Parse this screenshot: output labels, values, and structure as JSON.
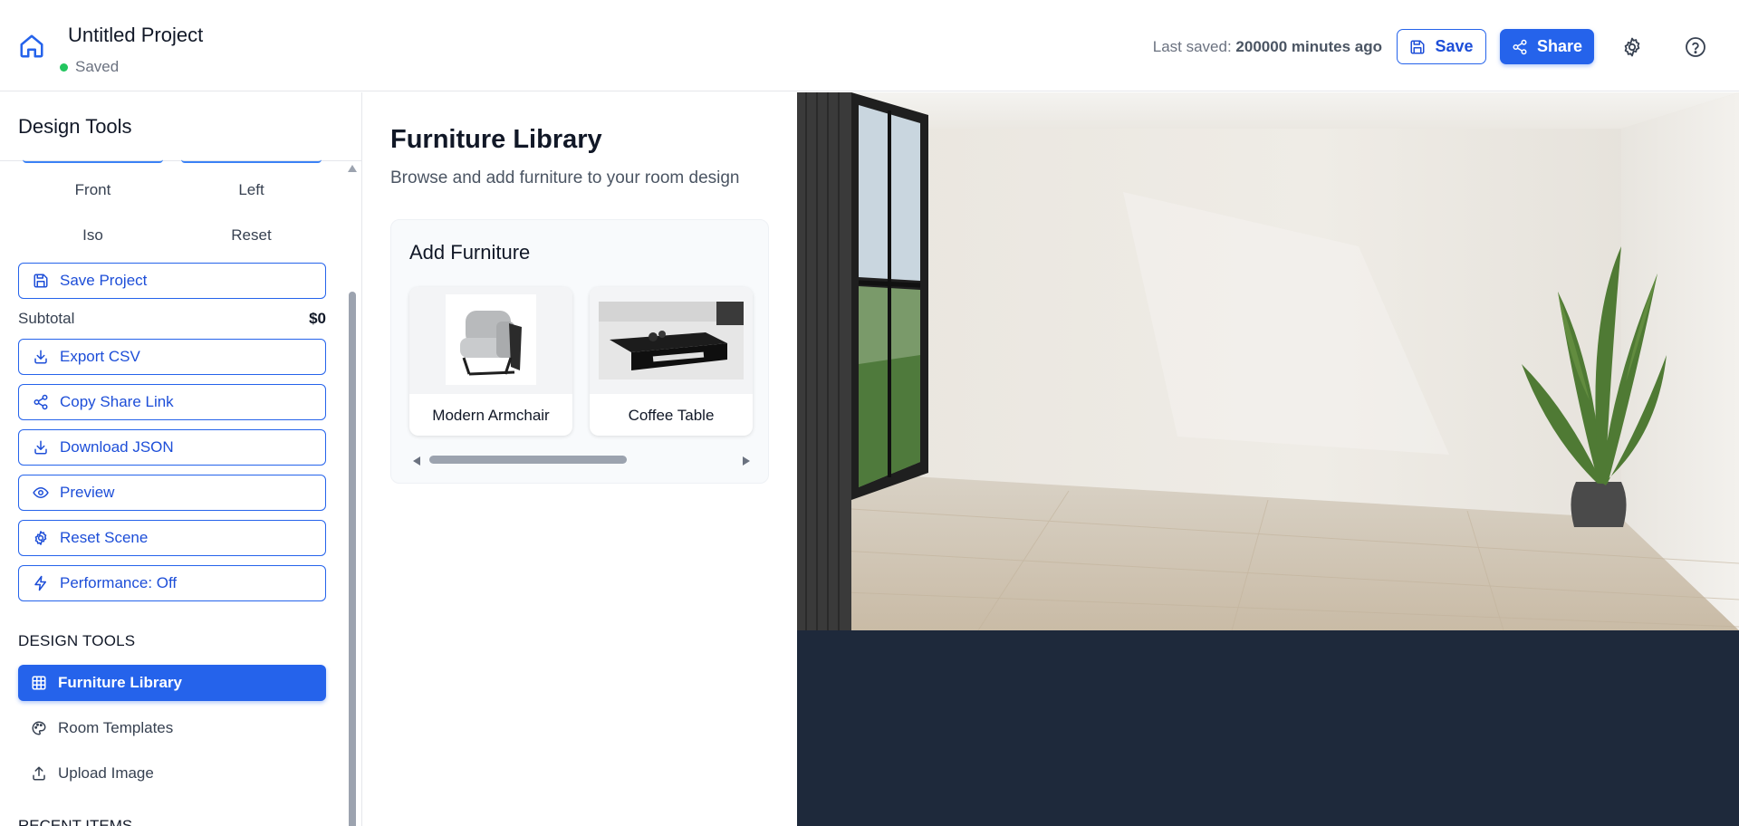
{
  "header": {
    "project_title": "Untitled Project",
    "status": "Saved",
    "last_saved_label": "Last saved:",
    "last_saved_value": "200000 minutes ago",
    "save_label": "Save",
    "share_label": "Share"
  },
  "sidebar": {
    "title": "Design Tools",
    "view_buttons": [
      "Front",
      "Left",
      "Iso",
      "Reset"
    ],
    "save_project": "Save Project",
    "subtotal_label": "Subtotal",
    "subtotal_value": "$0",
    "actions": [
      "Export CSV",
      "Copy Share Link",
      "Download JSON",
      "Preview",
      "Reset Scene",
      "Performance: Off"
    ],
    "section_title": "DESIGN TOOLS",
    "nav": [
      "Furniture Library",
      "Room Templates",
      "Upload Image"
    ],
    "next_section_title": "RECENT ITEMS"
  },
  "panel": {
    "title": "Furniture Library",
    "subtitle": "Browse and add furniture to your room design",
    "add_title": "Add Furniture",
    "items": [
      {
        "name": "Modern Armchair"
      },
      {
        "name": "Coffee Table"
      }
    ]
  },
  "colors": {
    "accent": "#2563eb",
    "viewport_bg": "#1e293b",
    "status_ok": "#22c55e"
  }
}
